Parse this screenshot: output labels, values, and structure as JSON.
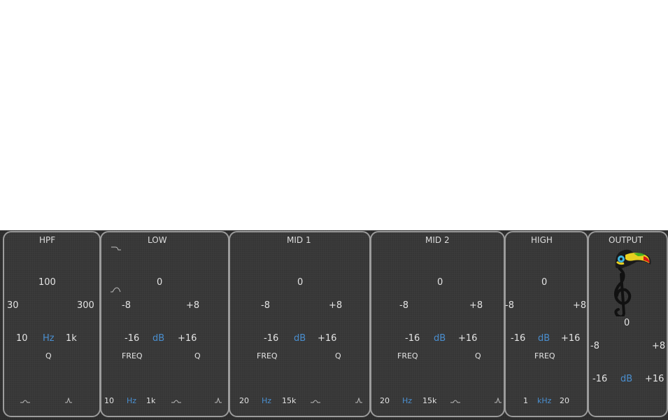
{
  "hpf": {
    "title": "HPF",
    "freq_scale": {
      "top": "100",
      "left": "30",
      "right": "300",
      "min": "10",
      "unit": "Hz",
      "max": "1k"
    },
    "q_label": "Q",
    "icons": [
      "peak-wide-icon",
      "peak-narrow-icon"
    ]
  },
  "low": {
    "title": "LOW",
    "gain_scale": {
      "top": "0",
      "left": "-8",
      "right": "+8",
      "min": "-16",
      "unit": "dB",
      "max": "+16"
    },
    "freq_label": "FREQ",
    "q_label": "Q",
    "freq_scale": {
      "min": "10",
      "unit": "Hz",
      "max": "1k"
    },
    "icons": [
      "shelf-icon",
      "bell-icon",
      "peak-wide-icon",
      "peak-narrow-icon"
    ]
  },
  "mid1": {
    "title": "MID 1",
    "gain_scale": {
      "top": "0",
      "left": "-8",
      "right": "+8",
      "min": "-16",
      "unit": "dB",
      "max": "+16"
    },
    "freq_label": "FREQ",
    "q_label": "Q",
    "freq_scale": {
      "min": "20",
      "unit": "Hz",
      "max": "15k"
    }
  },
  "mid2": {
    "title": "MID 2",
    "gain_scale": {
      "top": "0",
      "left": "-8",
      "right": "+8",
      "min": "-16",
      "unit": "dB",
      "max": "+16"
    },
    "freq_label": "FREQ",
    "q_label": "Q",
    "freq_scale": {
      "min": "20",
      "unit": "Hz",
      "max": "15k"
    }
  },
  "high": {
    "title": "HIGH",
    "gain_scale": {
      "top": "0",
      "left": "-8",
      "right": "+8",
      "min": "-16",
      "unit": "dB",
      "max": "+16"
    },
    "freq_label": "FREQ",
    "freq_scale": {
      "min": "1",
      "unit": "kHz",
      "max": "20"
    }
  },
  "output": {
    "title": "OUTPUT",
    "gain_scale": {
      "top": "0",
      "left": "-8",
      "right": "+8",
      "min": "-16",
      "unit": "dB",
      "max": "+16"
    },
    "logo": "toucan-treble-clef-logo"
  },
  "colors": {
    "background": "#2c2c2c",
    "panel": "#363636",
    "border": "#9c9c9c",
    "text": "#e4e4e4",
    "unit": "#4a8fd0"
  }
}
